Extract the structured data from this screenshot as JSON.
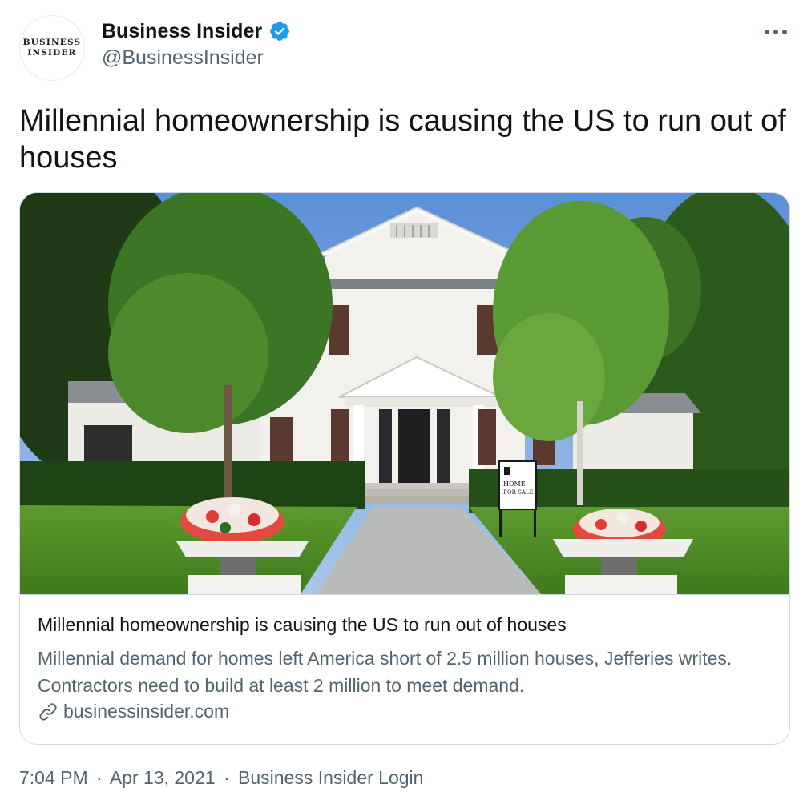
{
  "author": {
    "avatar_text": "BUSINESS\nINSIDER",
    "display_name": "Business Insider",
    "handle": "@BusinessInsider",
    "verified_color": "#1d9bf0",
    "verified_icon": "verified-badge-icon"
  },
  "more_icon": "more-horizontal-icon",
  "tweet": {
    "text": "Millennial homeownership is causing the US to run out of houses"
  },
  "card": {
    "image_alt": "White two-story house with a Home For Sale sign and flower planters on the lawn",
    "sign_text_line1": "HOME",
    "sign_text_line2": "FOR SALE",
    "title": "Millennial homeownership is causing the US to run out of houses",
    "description": "Millennial demand for homes left America short of 2.5 million houses, Jefferies writes. Contractors need to build at least 2 million to meet demand.",
    "domain": "businessinsider.com",
    "link_icon": "link-icon"
  },
  "meta": {
    "time": "7:04 PM",
    "separator": "·",
    "date": "Apr 13, 2021",
    "source": "Business Insider Login"
  },
  "colors": {
    "text_primary": "#0f1419",
    "text_secondary": "#536471",
    "border": "#cfd9de",
    "accent": "#1d9bf0"
  }
}
